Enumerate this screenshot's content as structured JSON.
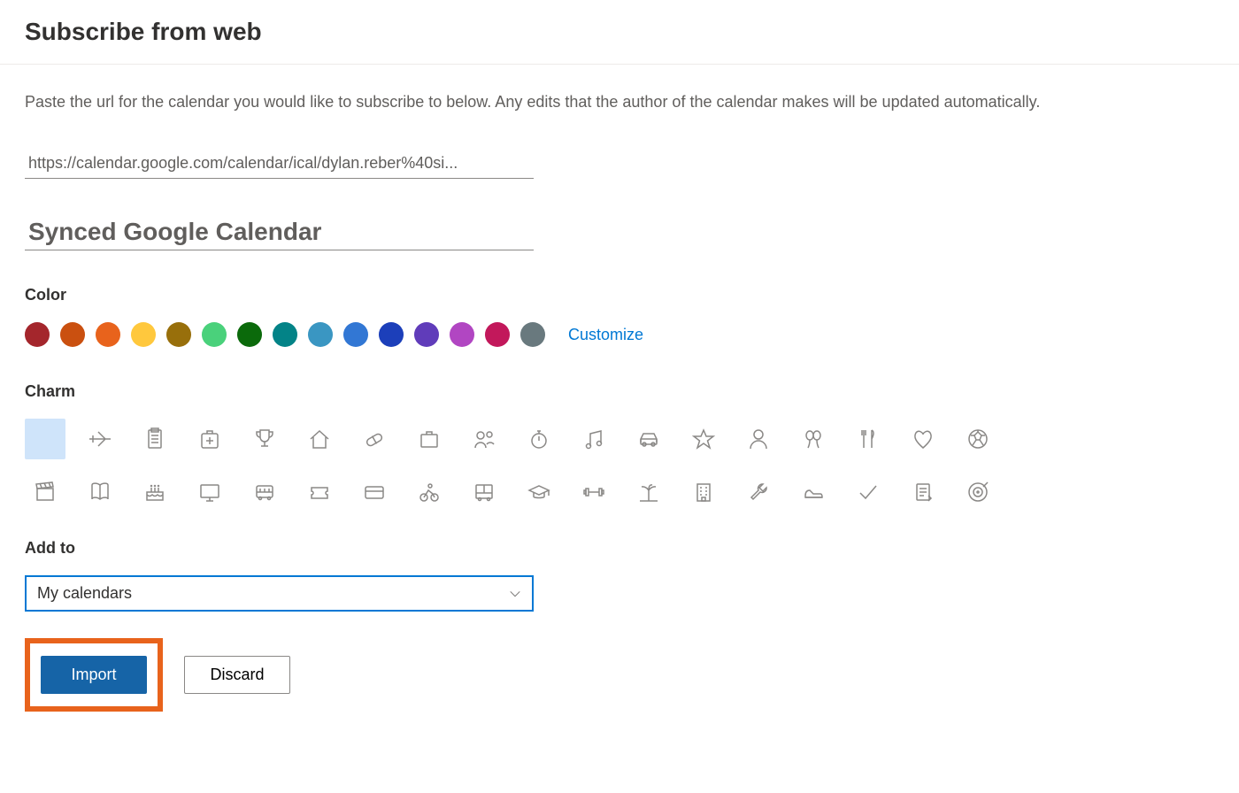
{
  "header": {
    "title": "Subscribe from web"
  },
  "description": "Paste the url for the calendar you would like to subscribe to below. Any edits that the author of the calendar makes will be updated automatically.",
  "url_input": {
    "value": "https://calendar.google.com/calendar/ical/dylan.reber%40si..."
  },
  "name_input": {
    "value": "Synced Google Calendar"
  },
  "color": {
    "label": "Color",
    "swatches": [
      "#a4262c",
      "#ca5010",
      "#e8631c",
      "#ffc83d",
      "#986f0b",
      "#4ad17b",
      "#0b6a0b",
      "#038387",
      "#3a96c2",
      "#3277d4",
      "#1c3fba",
      "#603cba",
      "#b146c2",
      "#c2185b",
      "#69797e"
    ],
    "customize_label": "Customize"
  },
  "charm": {
    "label": "Charm",
    "row1": [
      "none",
      "airplane",
      "clipboard",
      "firstaid",
      "trophy",
      "home",
      "pill",
      "briefcase",
      "people",
      "stopwatch",
      "music",
      "car",
      "star",
      "person",
      "balloons",
      "fork-knife",
      "heart",
      "soccer"
    ],
    "row2": [
      "clapperboard",
      "book",
      "cake",
      "monitor",
      "bus",
      "ticket",
      "creditcard",
      "cycling",
      "bus2",
      "gradcap",
      "dumbbell",
      "beach",
      "building",
      "wrench",
      "shoe",
      "checkmark",
      "notepad",
      "target"
    ],
    "selected": "none"
  },
  "add_to": {
    "label": "Add to",
    "selected": "My calendars"
  },
  "buttons": {
    "import": "Import",
    "discard": "Discard"
  }
}
